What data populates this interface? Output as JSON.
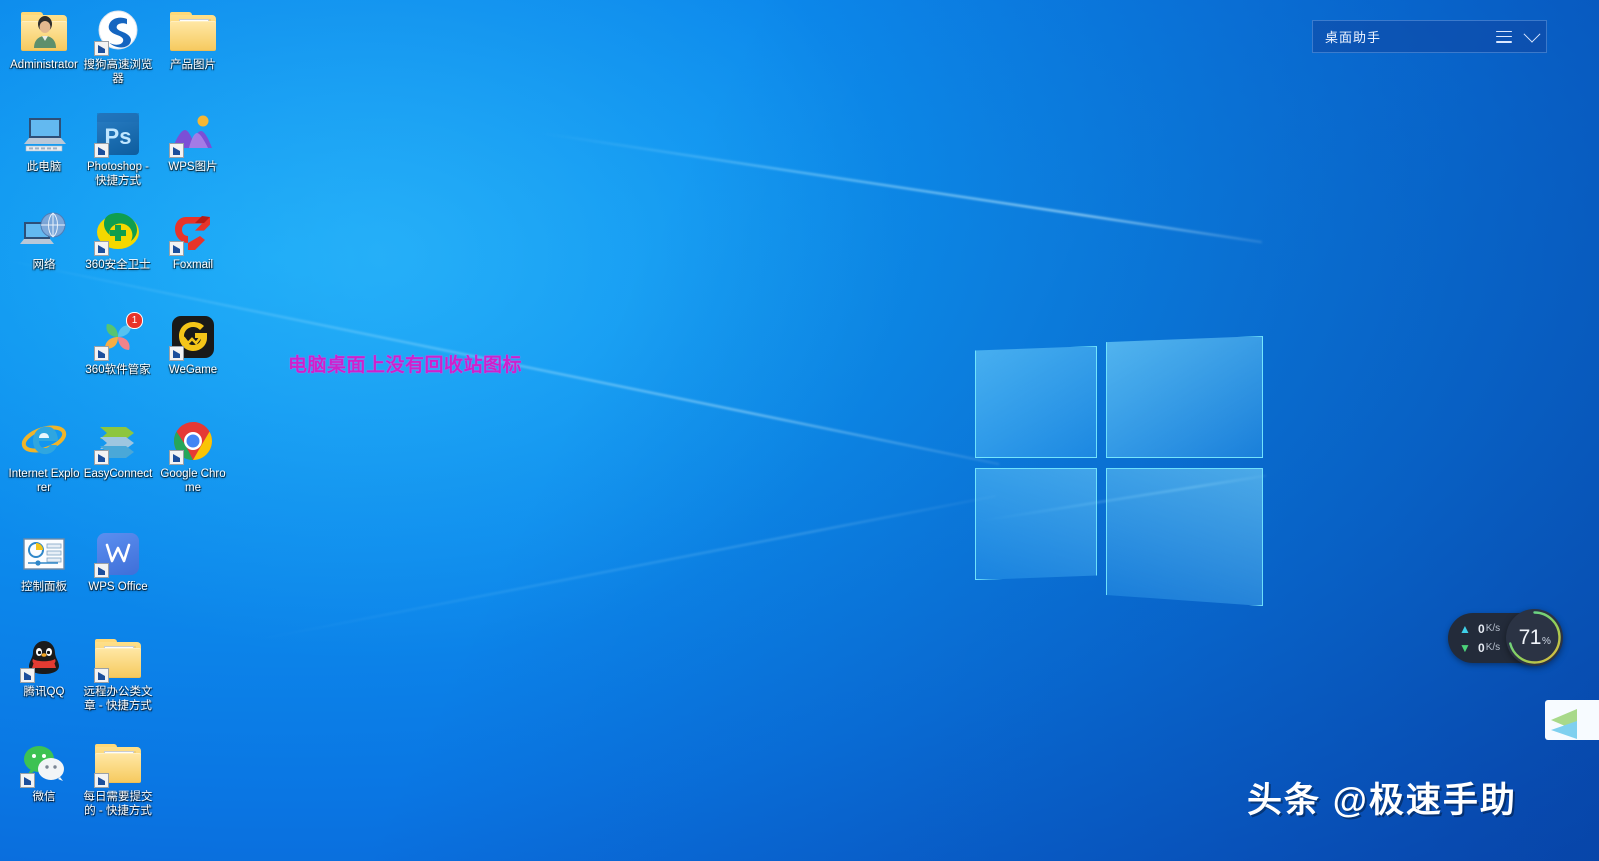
{
  "wallpaper": {
    "name": "windows-10-hero-blue",
    "accent": "#0a76e3",
    "highlight": "#12a3f5",
    "shadow": "#0a4fc2"
  },
  "desktop_icons": [
    {
      "label": "Administrator",
      "icon": "folder-user-icon",
      "art": "folder-user",
      "shortcut": false,
      "col": 0,
      "row": 0
    },
    {
      "label": "搜狗高速浏览器",
      "icon": "sogou-browser-icon",
      "art": "sogou",
      "shortcut": true,
      "col": 1,
      "row": 0
    },
    {
      "label": "产品图片",
      "icon": "folder-icon",
      "art": "folder",
      "shortcut": false,
      "col": 2,
      "row": 0
    },
    {
      "label": "此电脑",
      "icon": "this-pc-icon",
      "art": "thispc",
      "shortcut": false,
      "col": 0,
      "row": 1
    },
    {
      "label": "Photoshop - 快捷方式",
      "icon": "photoshop-icon",
      "art": "photoshop",
      "shortcut": true,
      "col": 1,
      "row": 1
    },
    {
      "label": "WPS图片",
      "icon": "wps-photos-icon",
      "art": "wpspic",
      "shortcut": true,
      "col": 2,
      "row": 1
    },
    {
      "label": "网络",
      "icon": "network-icon",
      "art": "network",
      "shortcut": false,
      "col": 0,
      "row": 2
    },
    {
      "label": "360安全卫士",
      "icon": "360-safe-icon",
      "art": "safe360",
      "shortcut": true,
      "col": 1,
      "row": 2
    },
    {
      "label": "Foxmail",
      "icon": "foxmail-icon",
      "art": "foxmail",
      "shortcut": true,
      "col": 2,
      "row": 2
    },
    {
      "label": "360软件管家",
      "icon": "360-software-manager-icon",
      "art": "sm360",
      "shortcut": true,
      "col": 1,
      "row": 3,
      "badge": "1"
    },
    {
      "label": "WeGame",
      "icon": "wegame-icon",
      "art": "wegame",
      "shortcut": true,
      "col": 2,
      "row": 3
    },
    {
      "label": "Internet Explorer",
      "icon": "internet-explorer-icon",
      "art": "ie",
      "shortcut": false,
      "col": 0,
      "row": 4
    },
    {
      "label": "EasyConnect",
      "icon": "easyconnect-icon",
      "art": "easyconnect",
      "shortcut": true,
      "col": 1,
      "row": 4
    },
    {
      "label": "Google Chrome",
      "icon": "google-chrome-icon",
      "art": "chrome",
      "shortcut": true,
      "col": 2,
      "row": 4
    },
    {
      "label": "控制面板",
      "icon": "control-panel-icon",
      "art": "controlpanel",
      "shortcut": false,
      "col": 0,
      "row": 5
    },
    {
      "label": "WPS Office",
      "icon": "wps-office-icon",
      "art": "wpsoffice",
      "shortcut": true,
      "col": 1,
      "row": 5
    },
    {
      "label": "腾讯QQ",
      "icon": "tencent-qq-icon",
      "art": "qq",
      "shortcut": true,
      "col": 0,
      "row": 6
    },
    {
      "label": "远程办公类文章 - 快捷方式",
      "icon": "folder-shortcut-icon",
      "art": "folder",
      "shortcut": true,
      "col": 1,
      "row": 6
    },
    {
      "label": "微信",
      "icon": "wechat-icon",
      "art": "wechat",
      "shortcut": true,
      "col": 0,
      "row": 7
    },
    {
      "label": "每日需要提交的 - 快捷方式",
      "icon": "folder-shortcut-icon",
      "art": "folder-green",
      "shortcut": true,
      "col": 1,
      "row": 7
    }
  ],
  "annotation": {
    "text": "电脑桌面上没有回收站图标",
    "color": "#cc22cc"
  },
  "assistant_widget": {
    "title": "桌面助手",
    "menu_icon": "hamburger-menu-icon",
    "collapse_icon": "chevron-down-icon"
  },
  "network_monitor": {
    "upload": {
      "value": "0",
      "unit": "K/s",
      "icon": "arrow-up-icon",
      "color": "#3fd0e8"
    },
    "download": {
      "value": "0",
      "unit": "K/s",
      "icon": "arrow-down-icon",
      "color": "#4cd47a"
    }
  },
  "cpu_gauge": {
    "value": "71",
    "percent_sign": "%",
    "fill_ratio": 0.71,
    "ring_start_color": "#4ad6a8",
    "ring_end_color": "#e8b93a"
  },
  "corner_icon": {
    "name": "tray-app-icon"
  },
  "watermark": {
    "text": "头条 @极速手助"
  }
}
